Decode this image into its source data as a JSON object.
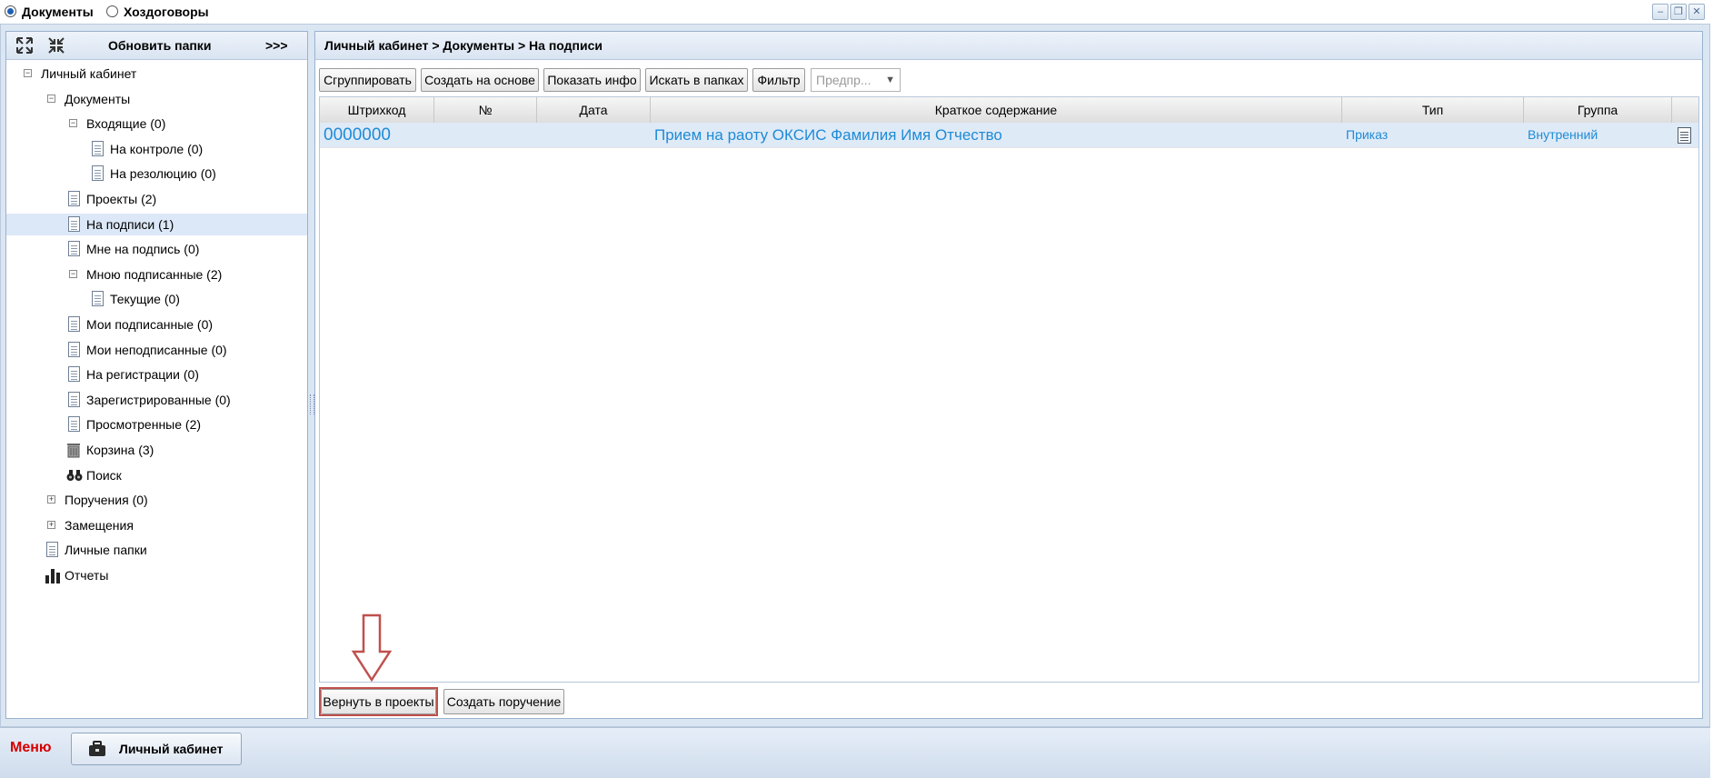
{
  "top_tabs": [
    {
      "label": "Документы",
      "selected": true
    },
    {
      "label": "Хоздоговоры",
      "selected": false
    }
  ],
  "window_controls": [
    "minimize-icon",
    "restore-icon",
    "close-icon"
  ],
  "left_panel": {
    "refresh_label": "Обновить папки",
    "expand_label": ">>>",
    "tree": [
      {
        "label": "Личный кабинет",
        "level": 0,
        "icon": "minus"
      },
      {
        "label": "Документы",
        "level": 1,
        "icon": "minus"
      },
      {
        "label": "Входящие (0)",
        "level": 2,
        "icon": "minus"
      },
      {
        "label": "На контроле (0)",
        "level": 3,
        "icon": "doc"
      },
      {
        "label": "На резолюцию (0)",
        "level": 3,
        "icon": "doc"
      },
      {
        "label": "Проекты (2)",
        "level": 2,
        "icon": "doc"
      },
      {
        "label": "На подписи (1)",
        "level": 2,
        "icon": "doc",
        "selected": true
      },
      {
        "label": "Мне на подпись (0)",
        "level": 2,
        "icon": "doc"
      },
      {
        "label": "Мною подписанные (2)",
        "level": 2,
        "icon": "minus"
      },
      {
        "label": "Текущие (0)",
        "level": 3,
        "icon": "doc"
      },
      {
        "label": "Мои подписанные (0)",
        "level": 2,
        "icon": "doc"
      },
      {
        "label": "Мои неподписанные (0)",
        "level": 2,
        "icon": "doc"
      },
      {
        "label": "На регистрации (0)",
        "level": 2,
        "icon": "doc"
      },
      {
        "label": "Зарегистрированные (0)",
        "level": 2,
        "icon": "doc"
      },
      {
        "label": "Просмотренные (2)",
        "level": 2,
        "icon": "doc"
      },
      {
        "label": "Корзина (3)",
        "level": 2,
        "icon": "trash"
      },
      {
        "label": "Поиск",
        "level": 2,
        "icon": "binoculars"
      },
      {
        "label": "Поручения (0)",
        "level": 1,
        "icon": "plus"
      },
      {
        "label": "Замещения",
        "level": 1,
        "icon": "plus"
      },
      {
        "label": "Личные папки",
        "level": 1,
        "icon": "doc"
      },
      {
        "label": "Отчеты",
        "level": 1,
        "icon": "chart"
      }
    ]
  },
  "breadcrumb": "Личный кабинет > Документы > На подписи",
  "toolbar": {
    "group": "Сгруппировать",
    "create_based": "Создать на основе",
    "show_info": "Показать инфо",
    "search_folders": "Искать в папках",
    "filter": "Фильтр",
    "select_placeholder": "Предпр..."
  },
  "grid": {
    "columns": [
      "Штрихкод",
      "№",
      "Дата",
      "Краткое содержание",
      "Тип",
      "Группа"
    ],
    "rows": [
      {
        "barcode": "0000000",
        "number": "",
        "date": "",
        "summary": "Прием на раоту ОКСИС Фамилия Имя Отчество",
        "type": "Приказ",
        "group": "Внутренний"
      }
    ]
  },
  "bottom_buttons": {
    "return": "Вернуть в проекты",
    "create_order": "Создать поручение"
  },
  "menu_bar": {
    "menu_label": "Меню",
    "cabinet_label": "Личный кабинет"
  },
  "colors": {
    "accent_link": "#1e8bd6",
    "menu_red": "#d40000",
    "highlight_border": "#c0504d"
  }
}
